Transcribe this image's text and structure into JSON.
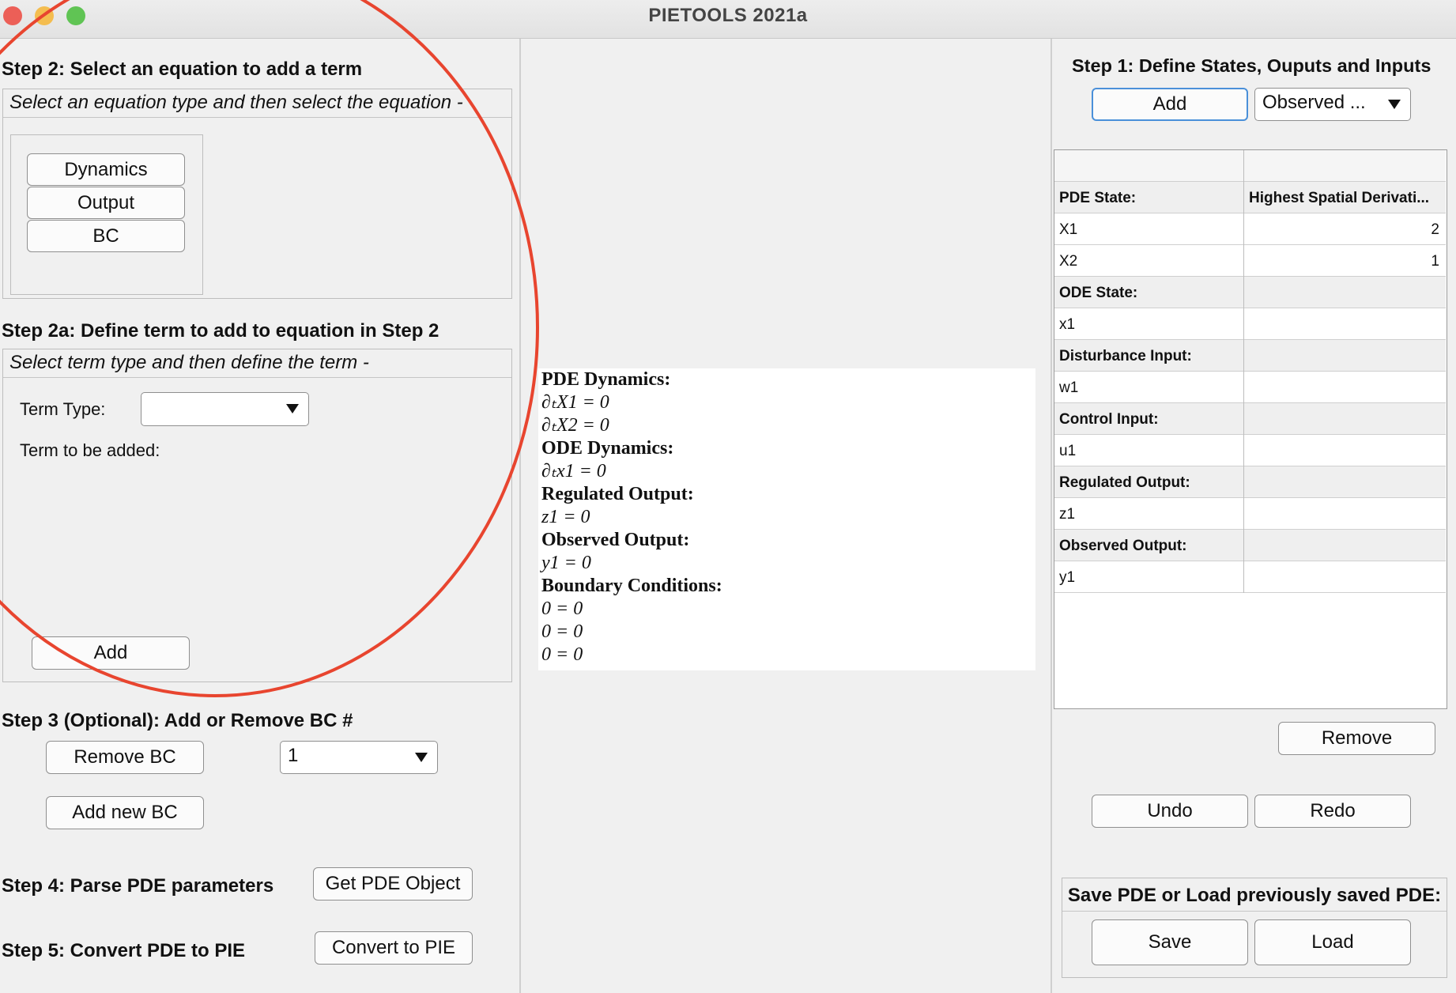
{
  "window": {
    "title": "PIETOOLS 2021a"
  },
  "step2": {
    "heading": "Step 2: Select an equation to add a term",
    "instruction": "Select an equation type and then select the equation -",
    "buttons": [
      "Dynamics",
      "Output",
      "BC"
    ]
  },
  "step2a": {
    "heading": "Step 2a: Define term to add to equation in Step 2",
    "instruction": "Select term type and then define the term -",
    "term_type_label": "Term Type:",
    "term_type_value": "",
    "term_added_label": "Term to be added:",
    "add_label": "Add"
  },
  "step3": {
    "heading": "Step 3 (Optional): Add or Remove BC #",
    "remove_label": "Remove BC",
    "bc_select_value": "1",
    "add_new_label": "Add new BC"
  },
  "step4": {
    "heading": "Step 4: Parse PDE parameters",
    "button_label": "Get PDE Object"
  },
  "step5": {
    "heading": "Step 5: Convert PDE to PIE",
    "button_label": "Convert to PIE"
  },
  "equations": [
    {
      "kind": "heading",
      "text": "PDE Dynamics:"
    },
    {
      "kind": "eq",
      "text": "∂ₜX1 = 0"
    },
    {
      "kind": "eq",
      "text": "∂ₜX2 = 0"
    },
    {
      "kind": "heading",
      "text": "ODE Dynamics:"
    },
    {
      "kind": "eq",
      "text": "∂ₜx1 = 0"
    },
    {
      "kind": "heading",
      "text": "Regulated Output:"
    },
    {
      "kind": "eq",
      "text": "z1 = 0"
    },
    {
      "kind": "heading",
      "text": "Observed Output:"
    },
    {
      "kind": "eq",
      "text": "y1 = 0"
    },
    {
      "kind": "heading",
      "text": "Boundary Conditions:"
    },
    {
      "kind": "eq",
      "text": "0 = 0"
    },
    {
      "kind": "eq",
      "text": "0 = 0"
    },
    {
      "kind": "eq",
      "text": "0 = 0"
    }
  ],
  "step1": {
    "heading": "Step 1: Define States, Ouputs and Inputs",
    "add_label": "Add",
    "type_select_value": "Observed ...",
    "table": {
      "rows": [
        {
          "c1": "",
          "c2": "",
          "style": "blank"
        },
        {
          "c1": "PDE State:",
          "c2": "Highest Spatial Derivati...",
          "style": "header"
        },
        {
          "c1": "X1",
          "c2": "2",
          "style": "data"
        },
        {
          "c1": "X2",
          "c2": "1",
          "style": "data"
        },
        {
          "c1": "ODE State:",
          "c2": "",
          "style": "header"
        },
        {
          "c1": "x1",
          "c2": "",
          "style": "data"
        },
        {
          "c1": "Disturbance Input:",
          "c2": "",
          "style": "header"
        },
        {
          "c1": "w1",
          "c2": "",
          "style": "data"
        },
        {
          "c1": "Control Input:",
          "c2": "",
          "style": "header"
        },
        {
          "c1": "u1",
          "c2": "",
          "style": "data"
        },
        {
          "c1": "Regulated Output:",
          "c2": "",
          "style": "header"
        },
        {
          "c1": "z1",
          "c2": "",
          "style": "data"
        },
        {
          "c1": "Observed Output:",
          "c2": "",
          "style": "header"
        },
        {
          "c1": "y1",
          "c2": "",
          "style": "data"
        }
      ]
    },
    "remove_label": "Remove",
    "undo_label": "Undo",
    "redo_label": "Redo"
  },
  "save_load": {
    "heading": "Save PDE or Load previously saved PDE:",
    "save_label": "Save",
    "load_label": "Load"
  },
  "colors": {
    "annotation_circle": "#e8452f",
    "primary_button_border": "#4a90d9"
  }
}
